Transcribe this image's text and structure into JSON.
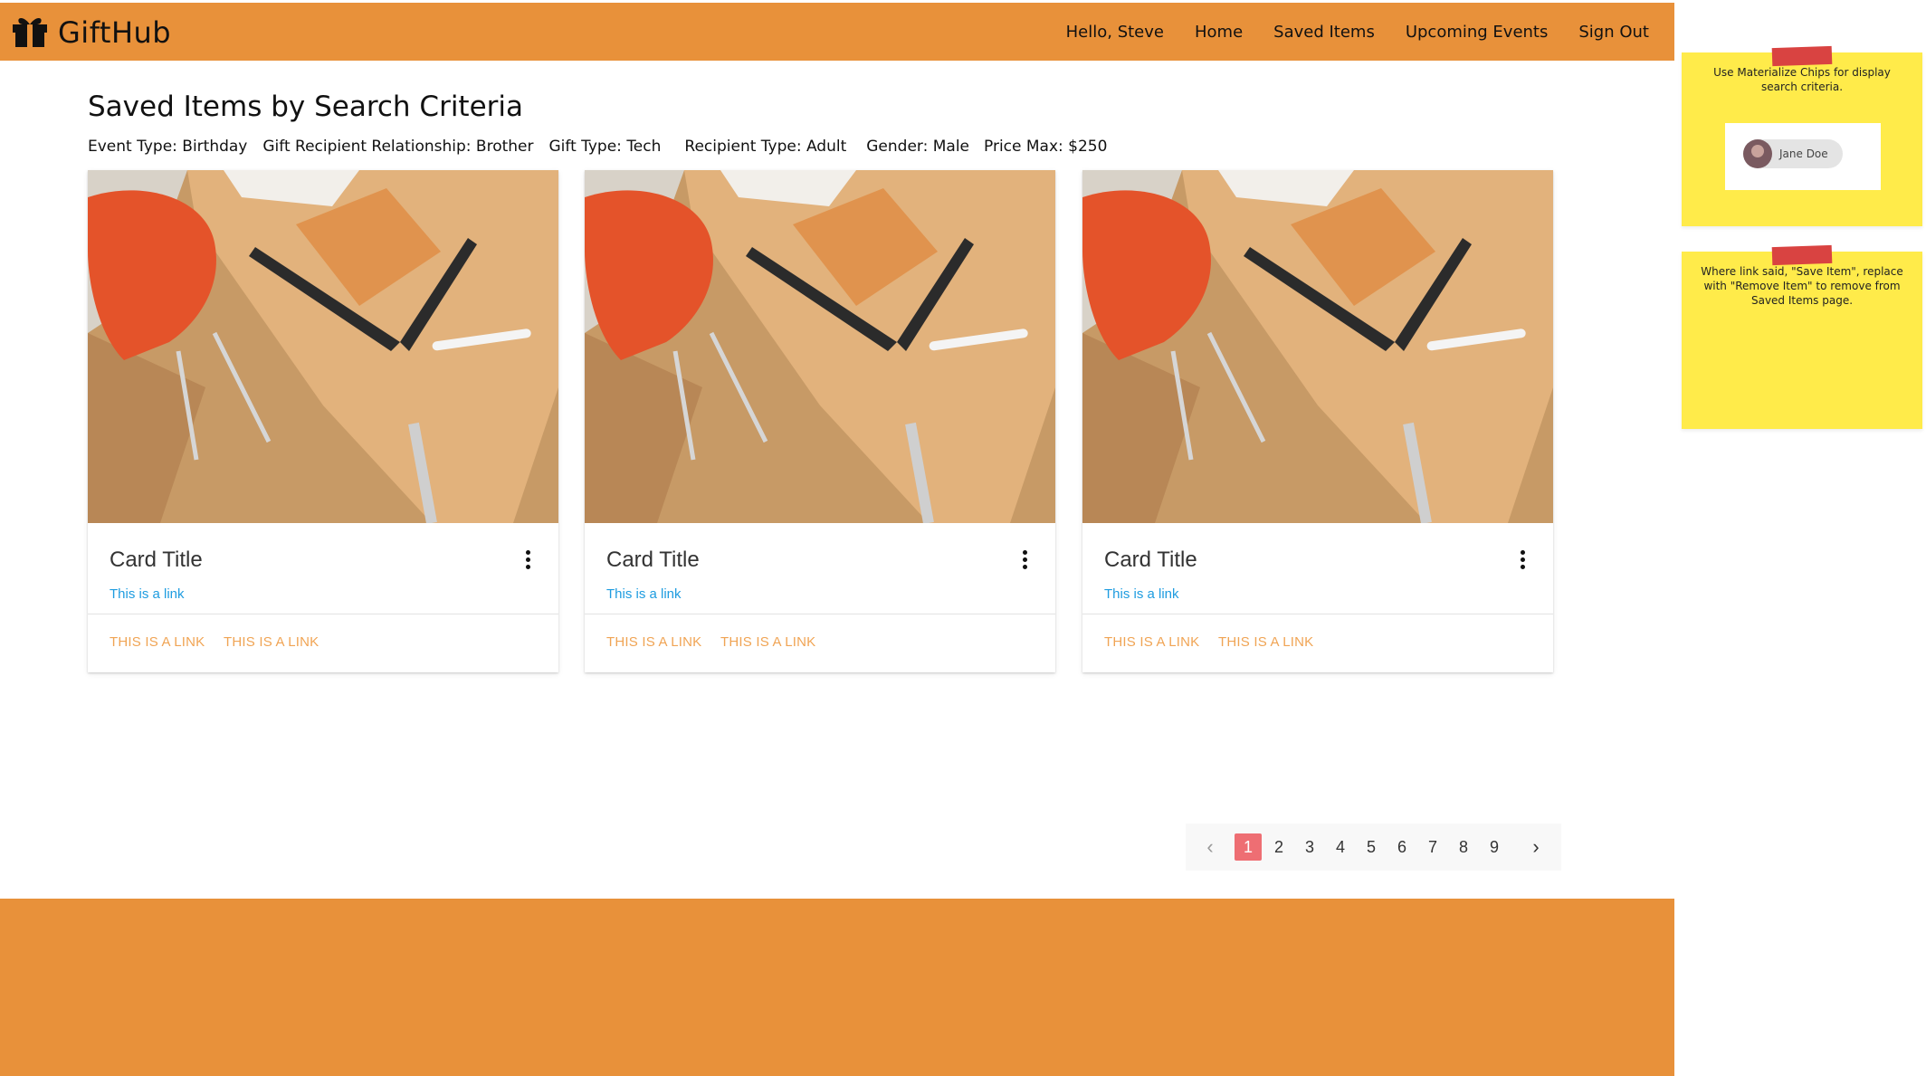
{
  "colors": {
    "nav": "#E8913A",
    "footer": "#E8913A",
    "link": "#1e9ce0",
    "action": "#F0A454",
    "active_page": "#EE6E73",
    "note": "#FFEB4A",
    "tape": "#D94341"
  },
  "nav": {
    "brand": "GiftHub",
    "brand_icon": "gift-icon",
    "greeting": "Hello, Steve",
    "links": [
      "Home",
      "Saved Items",
      "Upcoming Events",
      "Sign Out"
    ]
  },
  "page": {
    "title": "Saved Items by Search Criteria",
    "criteria": [
      "Event Type: Birthday",
      "Gift Recipient Relationship: Brother",
      "Gift Type: Tech",
      "Recipient Type: Adult",
      "Gender: Male",
      "Price Max: $250"
    ]
  },
  "cards": [
    {
      "title": "Card Title",
      "sublink": "This is a link",
      "actions": [
        "THIS IS A LINK",
        "THIS IS A LINK"
      ]
    },
    {
      "title": "Card Title",
      "sublink": "This is a link",
      "actions": [
        "THIS IS A LINK",
        "THIS IS A LINK"
      ]
    },
    {
      "title": "Card Title",
      "sublink": "This is a link",
      "actions": [
        "THIS IS A LINK",
        "THIS IS A LINK"
      ]
    }
  ],
  "pagination": {
    "pages": [
      "1",
      "2",
      "3",
      "4",
      "5",
      "6",
      "7",
      "8",
      "9"
    ],
    "active": "1",
    "prev_icon": "chevron-left-icon",
    "next_icon": "chevron-right-icon"
  },
  "notes": [
    {
      "text": "Use Materialize Chips for display search criteria.",
      "chip_label": "Jane Doe"
    },
    {
      "text": "Where link said, \"Save Item\", replace with \"Remove Item\" to remove from Saved Items page."
    }
  ]
}
